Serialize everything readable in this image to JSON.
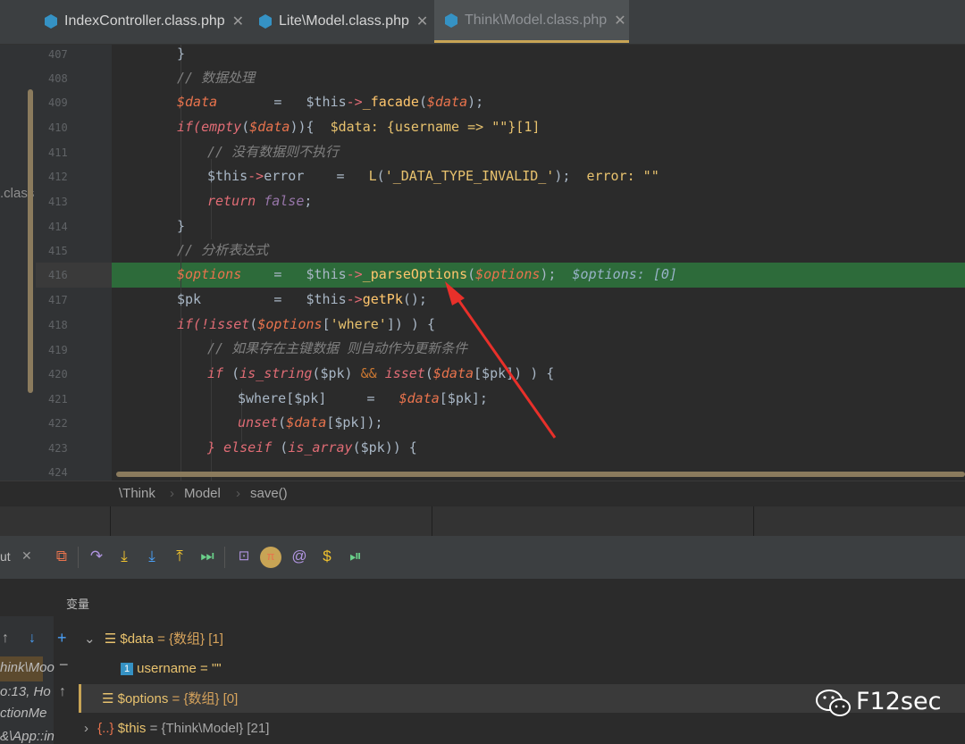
{
  "tabs": [
    {
      "label": "IndexController.class.php",
      "active": false
    },
    {
      "label": "Lite\\Model.class.php",
      "active": false
    },
    {
      "label": "Think\\Model.class.php",
      "active": true
    }
  ],
  "side_fragment": ".class",
  "line_numbers": [
    "407",
    "408",
    "409",
    "410",
    "411",
    "412",
    "413",
    "414",
    "415",
    "416",
    "417",
    "418",
    "419",
    "420",
    "421",
    "422",
    "423",
    "424"
  ],
  "code": {
    "l407": "}",
    "l408": "// 数据处理",
    "l409": {
      "var": "$data",
      "eq": "=",
      "this": "$this",
      "arrow": "->",
      "fn": "_facade",
      "arg": "$data",
      "end": ");"
    },
    "l410": {
      "kw": "if(",
      "fn": "empty",
      "arg": "$data",
      "end": ")){",
      "hint": "$data: {username => \"\"}[1]"
    },
    "l411": "// 没有数据则不执行",
    "l412": {
      "this": "$this",
      "arrow": "->",
      "prop": "error",
      "eq": "=",
      "fn": "L",
      "str": "'_DATA_TYPE_INVALID_'",
      "end": ");",
      "hint": "error: \"\""
    },
    "l413": {
      "kw": "return",
      "val": "false",
      "end": ";"
    },
    "l414": "}",
    "l415": "// 分析表达式",
    "l416": {
      "var": "$options",
      "eq": "=",
      "this": "$this",
      "arrow": "->",
      "fn": "_parseOptions",
      "arg": "$options",
      "end": ");",
      "hint": "$options: [0]"
    },
    "l417": {
      "var": "$pk",
      "eq": "=",
      "this": "$this",
      "arrow": "->",
      "fn": "getPk",
      "end": "();"
    },
    "l418": {
      "kw": "if(!",
      "fn": "isset",
      "arg": "$options",
      "key": "'where'",
      "end": "]) ) {"
    },
    "l419": "// 如果存在主键数据 则自动作为更新条件",
    "l420": {
      "kw": "if",
      "fn": "is_string",
      "pk": "$pk",
      "op": "&&",
      "fn2": "isset",
      "arg": "$data",
      "end": "]) ) {"
    },
    "l421": {
      "var": "$where",
      "pk": "$pk",
      "eq": "=",
      "arg": "$data",
      "end": "];"
    },
    "l422": {
      "fn": "unset",
      "arg": "$data",
      "pk": "$pk",
      "end": "]);"
    },
    "l423": {
      "kw": "} elseif",
      "fn": "is_array",
      "pk": "$pk",
      "end": ")) {"
    }
  },
  "breadcrumb": [
    "\\Think",
    "Model",
    "save()"
  ],
  "debug_tab": "ut",
  "variables_header": "变量",
  "frames": [
    "hink\\Moo",
    "o:13, Ho",
    "ctionMe",
    "&\\App::in"
  ],
  "variables": [
    {
      "name": "$data",
      "value": "= {数组} [1]",
      "expanded": true
    },
    {
      "name": "username",
      "value": "= \"\"",
      "child": true
    },
    {
      "name": "$options",
      "value": "= {数组} [0]",
      "selected": true
    },
    {
      "name": "$this",
      "value": "= {Think\\Model} [21]"
    }
  ],
  "watermark": "F12sec",
  "colors": {
    "highlight": "#2d6b3a",
    "arrow": "#e8302a",
    "accent": "#c8a455"
  }
}
